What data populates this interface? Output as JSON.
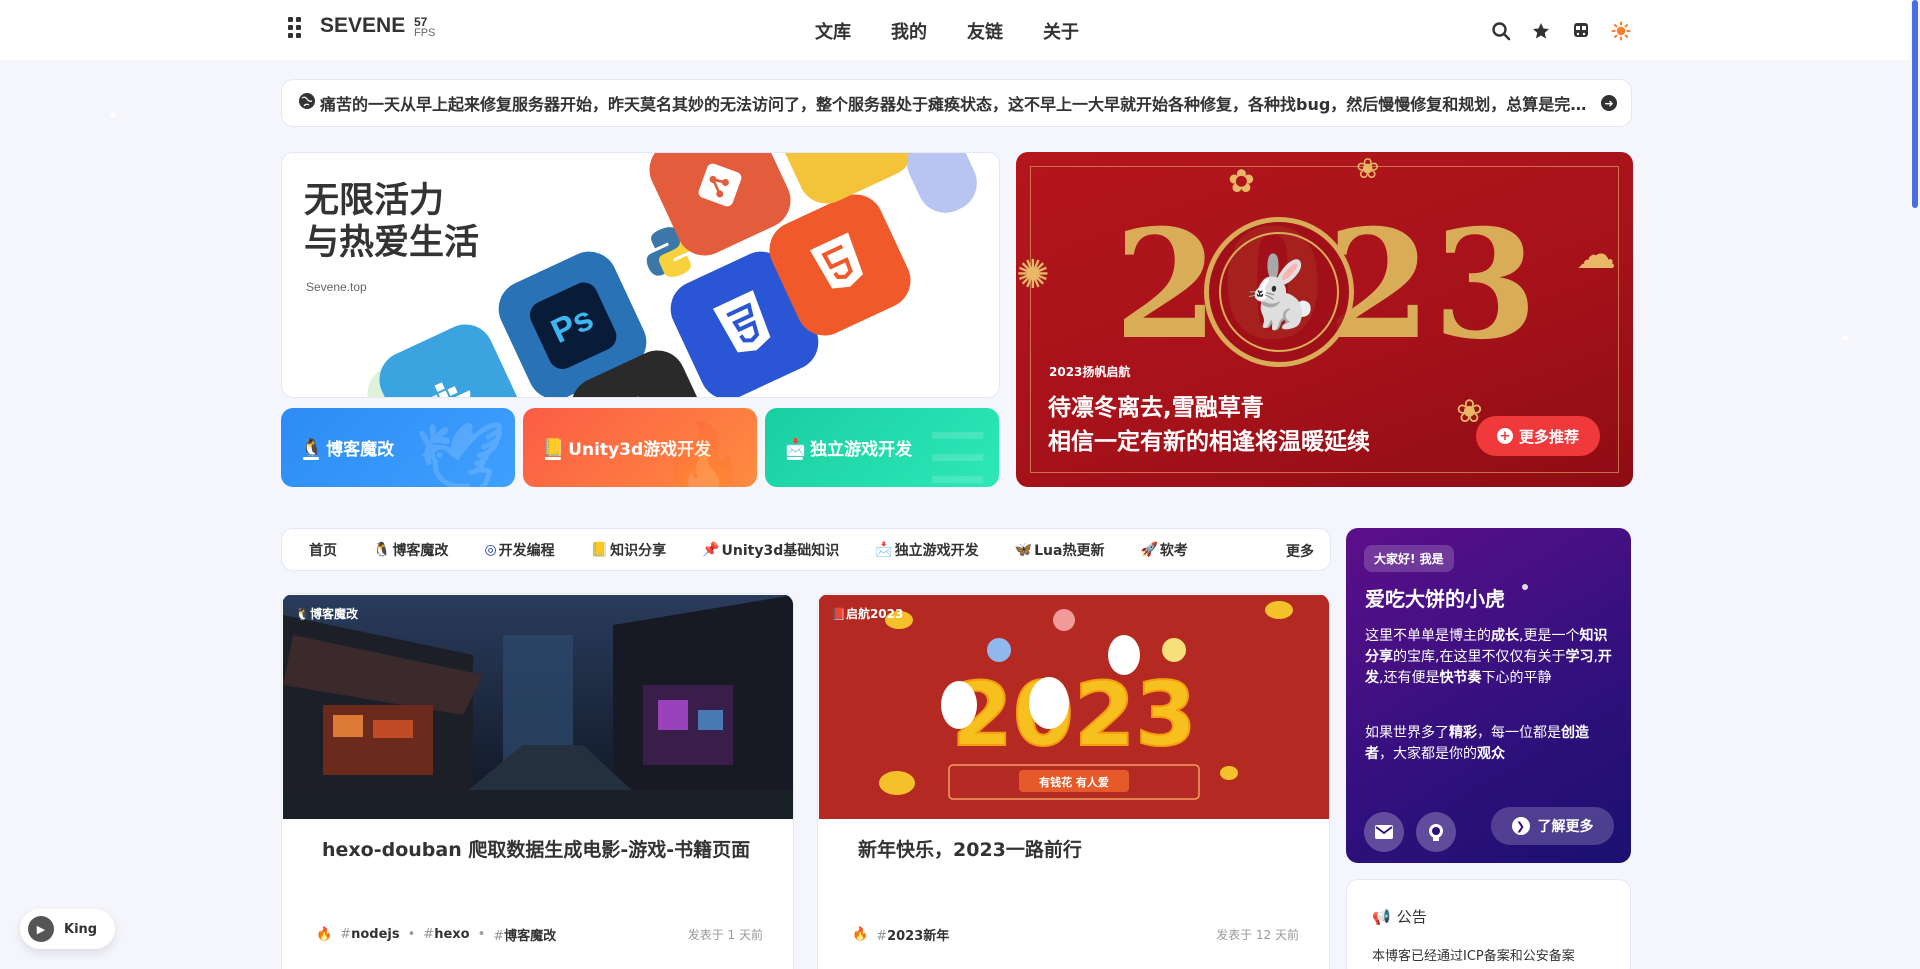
{
  "header": {
    "brand": "SEVENE",
    "fps_value": "57",
    "fps_label": "FPS",
    "nav": [
      "文库",
      "我的",
      "友链",
      "关于"
    ]
  },
  "notice": {
    "text": "痛苦的一天从早上起来修复服务器开始，昨天莫名其妙的无法访问了，整个服务器处于瘫痪状态，这不早上一大早就开始各种修复，各种找bug，然后慢慢修复和规划，总算是完全恢复"
  },
  "hero_left": {
    "title_line1": "无限活力",
    "title_line2": "与热爱生活",
    "site": "Sevene.top"
  },
  "categories": [
    {
      "label": "博客魔改",
      "color": "#2f8ff6"
    },
    {
      "label": "Unity3d游戏开发",
      "color": "#fb6a3a"
    },
    {
      "label": "独立游戏开发",
      "color": "#20d3a8"
    }
  ],
  "hero_right": {
    "year": "2023",
    "tag": "2023扬帆启航",
    "line1": "待凛冬离去,雪融草青",
    "line2": "相信一定有新的相逢将温暖延续",
    "more_label": "更多推荐"
  },
  "catbar": {
    "items": [
      "首页",
      "博客魔改",
      "开发编程",
      "知识分享",
      "Unity3d基础知识",
      "独立游戏开发",
      "Lua热更新",
      "软考"
    ],
    "more_label": "更多"
  },
  "posts": [
    {
      "category": "博客魔改",
      "title": "hexo-douban 爬取数据生成电影-游戏-书籍页面",
      "tags": [
        "nodejs",
        "hexo",
        "博客魔改"
      ],
      "date": "发表于 1 天前"
    },
    {
      "category": "启航2023",
      "title": "新年快乐，2023一路前行",
      "tags": [
        "2023新年"
      ],
      "date": "发表于 12 天前",
      "cover_text": "2023",
      "cover_banner": "有钱花 有人爱"
    }
  ],
  "author": {
    "greeting": "大家好! 我是",
    "name": "爱吃大饼的小虎",
    "p1": {
      "a": "这里不单单是博主的",
      "b": "成长",
      "c": ",更是一个",
      "d": "知识分享",
      "e": "的宝库,在这里不仅仅有关于",
      "f": "学习",
      "g": ",",
      "h": "开发",
      "i": ",还有便是",
      "j": "快节奏",
      "k": "下心的平静"
    },
    "p2": {
      "a": "如果世界多了",
      "b": "精彩",
      "c": "，每一位都是",
      "d": "创造者",
      "e": "，大家都是你的",
      "f": "观众"
    },
    "learn_more": "了解更多"
  },
  "bulletin": {
    "title": "公告",
    "body": "本博客已经通过ICP备案和公安备案"
  },
  "player": {
    "track": "King"
  },
  "colors": {
    "accent": "#f0393b",
    "scroll": "#4a6ee0"
  }
}
